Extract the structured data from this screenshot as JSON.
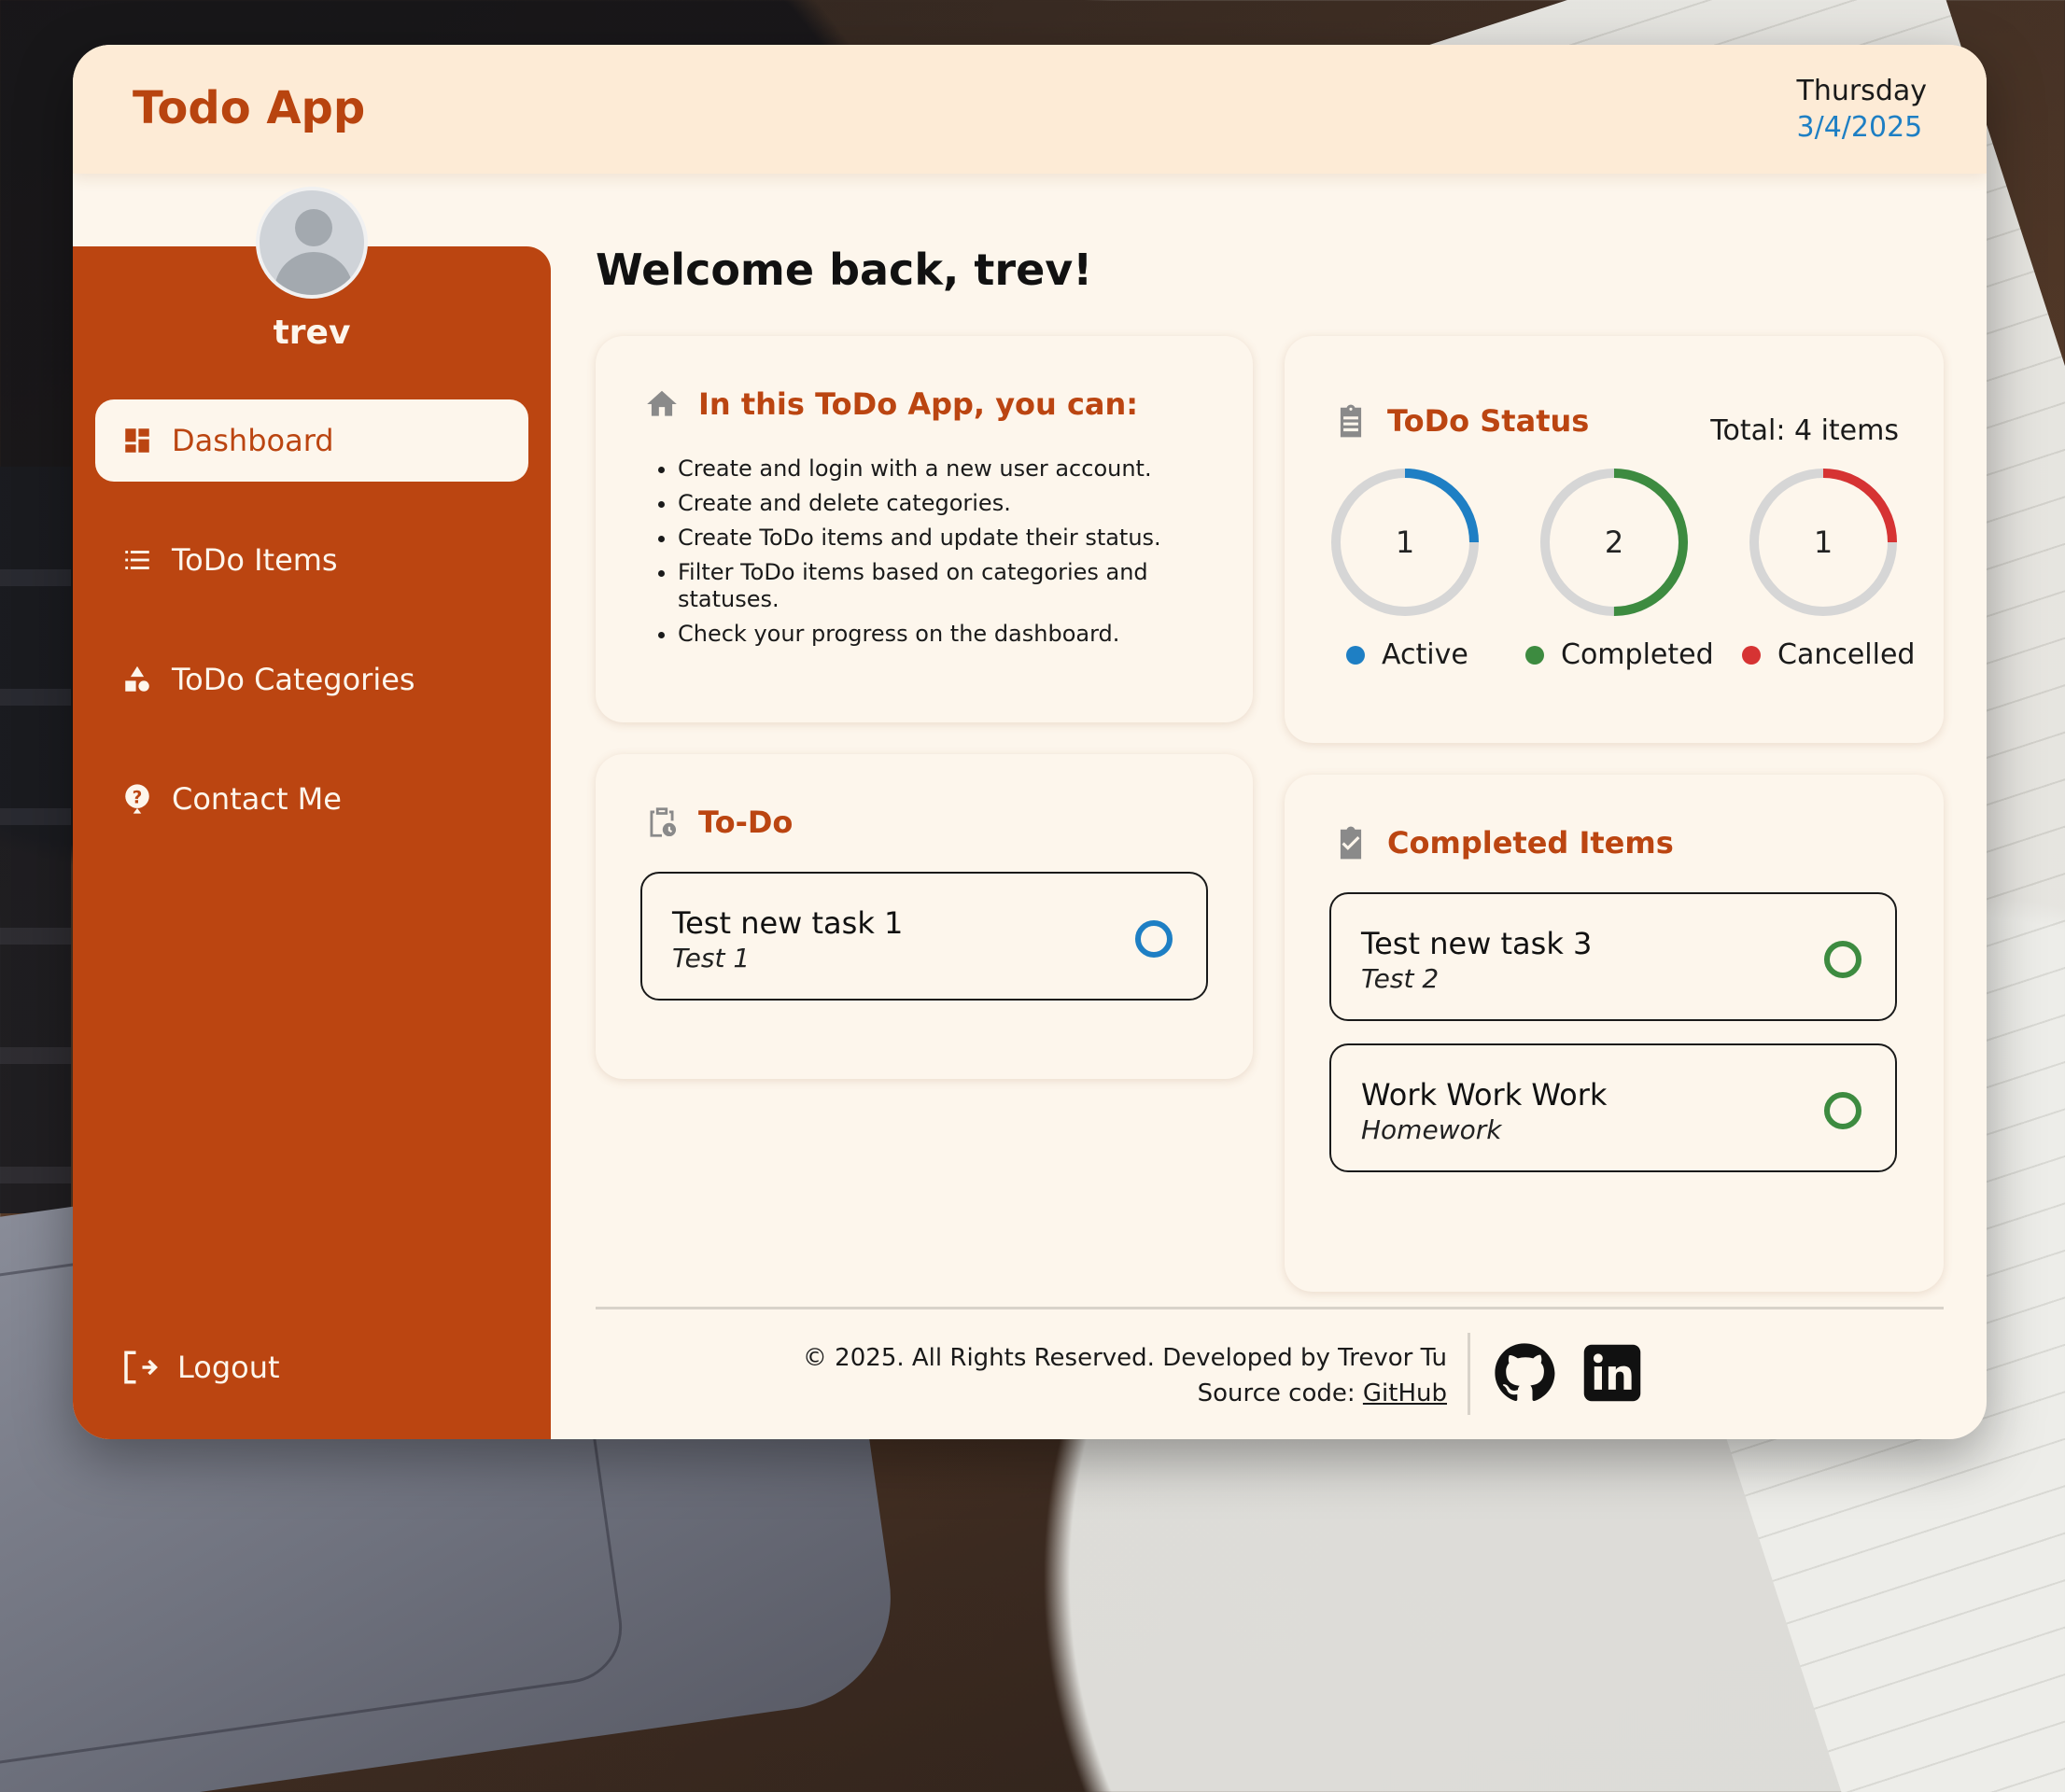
{
  "header": {
    "title": "Todo App",
    "day": "Thursday",
    "date": "3/4/2025"
  },
  "user": {
    "name": "trev"
  },
  "sidebar": {
    "items": [
      {
        "label": "Dashboard",
        "icon": "dashboard-icon",
        "active": true
      },
      {
        "label": "ToDo Items",
        "icon": "list-icon",
        "active": false
      },
      {
        "label": "ToDo Categories",
        "icon": "shapes-icon",
        "active": false
      },
      {
        "label": "Contact Me",
        "icon": "help-icon",
        "active": false
      }
    ],
    "logout": "Logout"
  },
  "welcome": "Welcome back, trev!",
  "features": {
    "title": "In this ToDo App, you can:",
    "items": [
      "Create and login with a new user account.",
      "Create and delete categories.",
      "Create ToDo items and update their status.",
      "Filter ToDo items based on categories and statuses.",
      "Check your progress on the dashboard."
    ]
  },
  "status": {
    "title": "ToDo Status",
    "total": "Total: 4 items",
    "chart_data": {
      "type": "donut",
      "total": 4,
      "series": [
        {
          "name": "Active",
          "value": 1,
          "color": "#1e7fc4"
        },
        {
          "name": "Completed",
          "value": 2,
          "color": "#3d8b40"
        },
        {
          "name": "Cancelled",
          "value": 1,
          "color": "#d63333"
        }
      ]
    }
  },
  "todo": {
    "title": "To-Do",
    "tasks": [
      {
        "name": "Test new task 1",
        "category": "Test 1",
        "color": "#1e7fc4"
      }
    ]
  },
  "completed": {
    "title": "Completed Items",
    "tasks": [
      {
        "name": "Test new task 3",
        "category": "Test 2",
        "color": "#3d8b40"
      },
      {
        "name": "Work Work Work",
        "category": "Homework",
        "color": "#3d8b40"
      }
    ]
  },
  "footer": {
    "copyright": "© 2025. All Rights Reserved. Developed by Trevor Tu",
    "source_prefix": "Source code: ",
    "source_link": "GitHub",
    "social": [
      "github-icon",
      "linkedin-icon"
    ]
  },
  "colors": {
    "accent": "#bb4511",
    "background": "#fdf6ec",
    "header": "#fdebd6"
  }
}
